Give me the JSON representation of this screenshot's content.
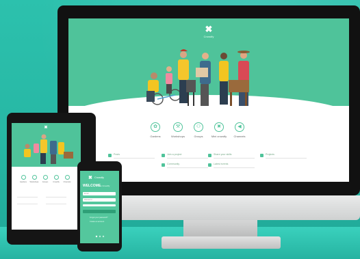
{
  "brand": {
    "name": "Crowdfy",
    "logo_icon": "x-cross-logo-icon"
  },
  "desktop": {
    "categories": [
      {
        "icon": "plant-icon",
        "label": "Gardens"
      },
      {
        "icon": "tools-icon",
        "label": "Workshops"
      },
      {
        "icon": "people-icon",
        "label": "Groups"
      },
      {
        "icon": "x-cross-icon",
        "label": "Mini crowdfy"
      },
      {
        "icon": "megaphone-icon",
        "label": "Channels"
      }
    ],
    "feed_items": [
      "Posts",
      "Join a project",
      "Share your skills",
      "Projects",
      "Community",
      "Latest events"
    ]
  },
  "tablet": {
    "categories": [
      {
        "label": "Gardens"
      },
      {
        "label": "Workshops"
      },
      {
        "label": "Groups"
      },
      {
        "label": "Crowdfy"
      },
      {
        "label": "Channels"
      }
    ]
  },
  "phone": {
    "brand": "Crowdfy",
    "title": "WELCOME",
    "subtitle": "to Crowdfy",
    "email_placeholder": "Email",
    "password_placeholder": "Password",
    "forgot_text": "Forgot your password?",
    "signup_text": "Create an account"
  },
  "colors": {
    "brand_green": "#4fc39a",
    "background_teal": "#2cc1ad",
    "device_black": "#111111"
  }
}
